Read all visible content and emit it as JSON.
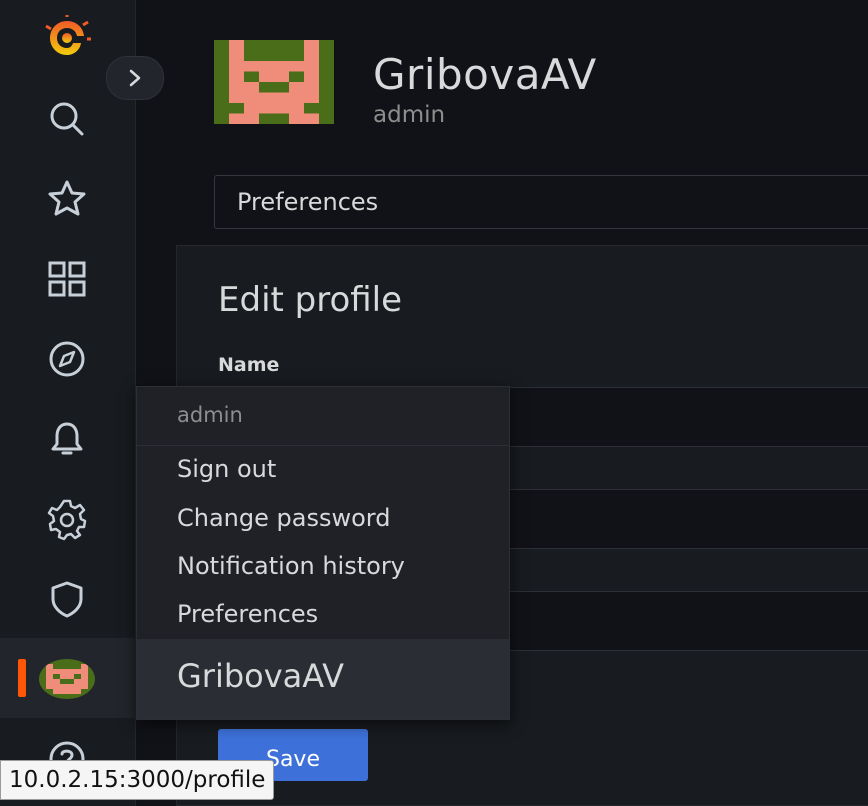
{
  "user": {
    "name": "GribovaAV",
    "role": "admin"
  },
  "tabs": {
    "active": "Preferences"
  },
  "edit_profile": {
    "title": "Edit profile",
    "name_label": "Name",
    "save_label": "Save"
  },
  "user_menu": {
    "header": "admin",
    "items": [
      "Sign out",
      "Change password",
      "Notification history",
      "Preferences"
    ],
    "footer": "GribovaAV"
  },
  "status_bar": {
    "url": "10.0.2.15:3000/profile"
  },
  "sidebar": {
    "icons": [
      "grafana-logo-icon",
      "search-icon",
      "star-icon",
      "dashboards-icon",
      "explore-icon",
      "alerting-bell-icon",
      "gear-icon",
      "shield-icon",
      "help-icon"
    ]
  },
  "colors": {
    "accent": "#ff5705",
    "primary_button": "#3d71d9",
    "avatar_bg": "#4a6d1a",
    "avatar_fg": "#f08c7a"
  }
}
